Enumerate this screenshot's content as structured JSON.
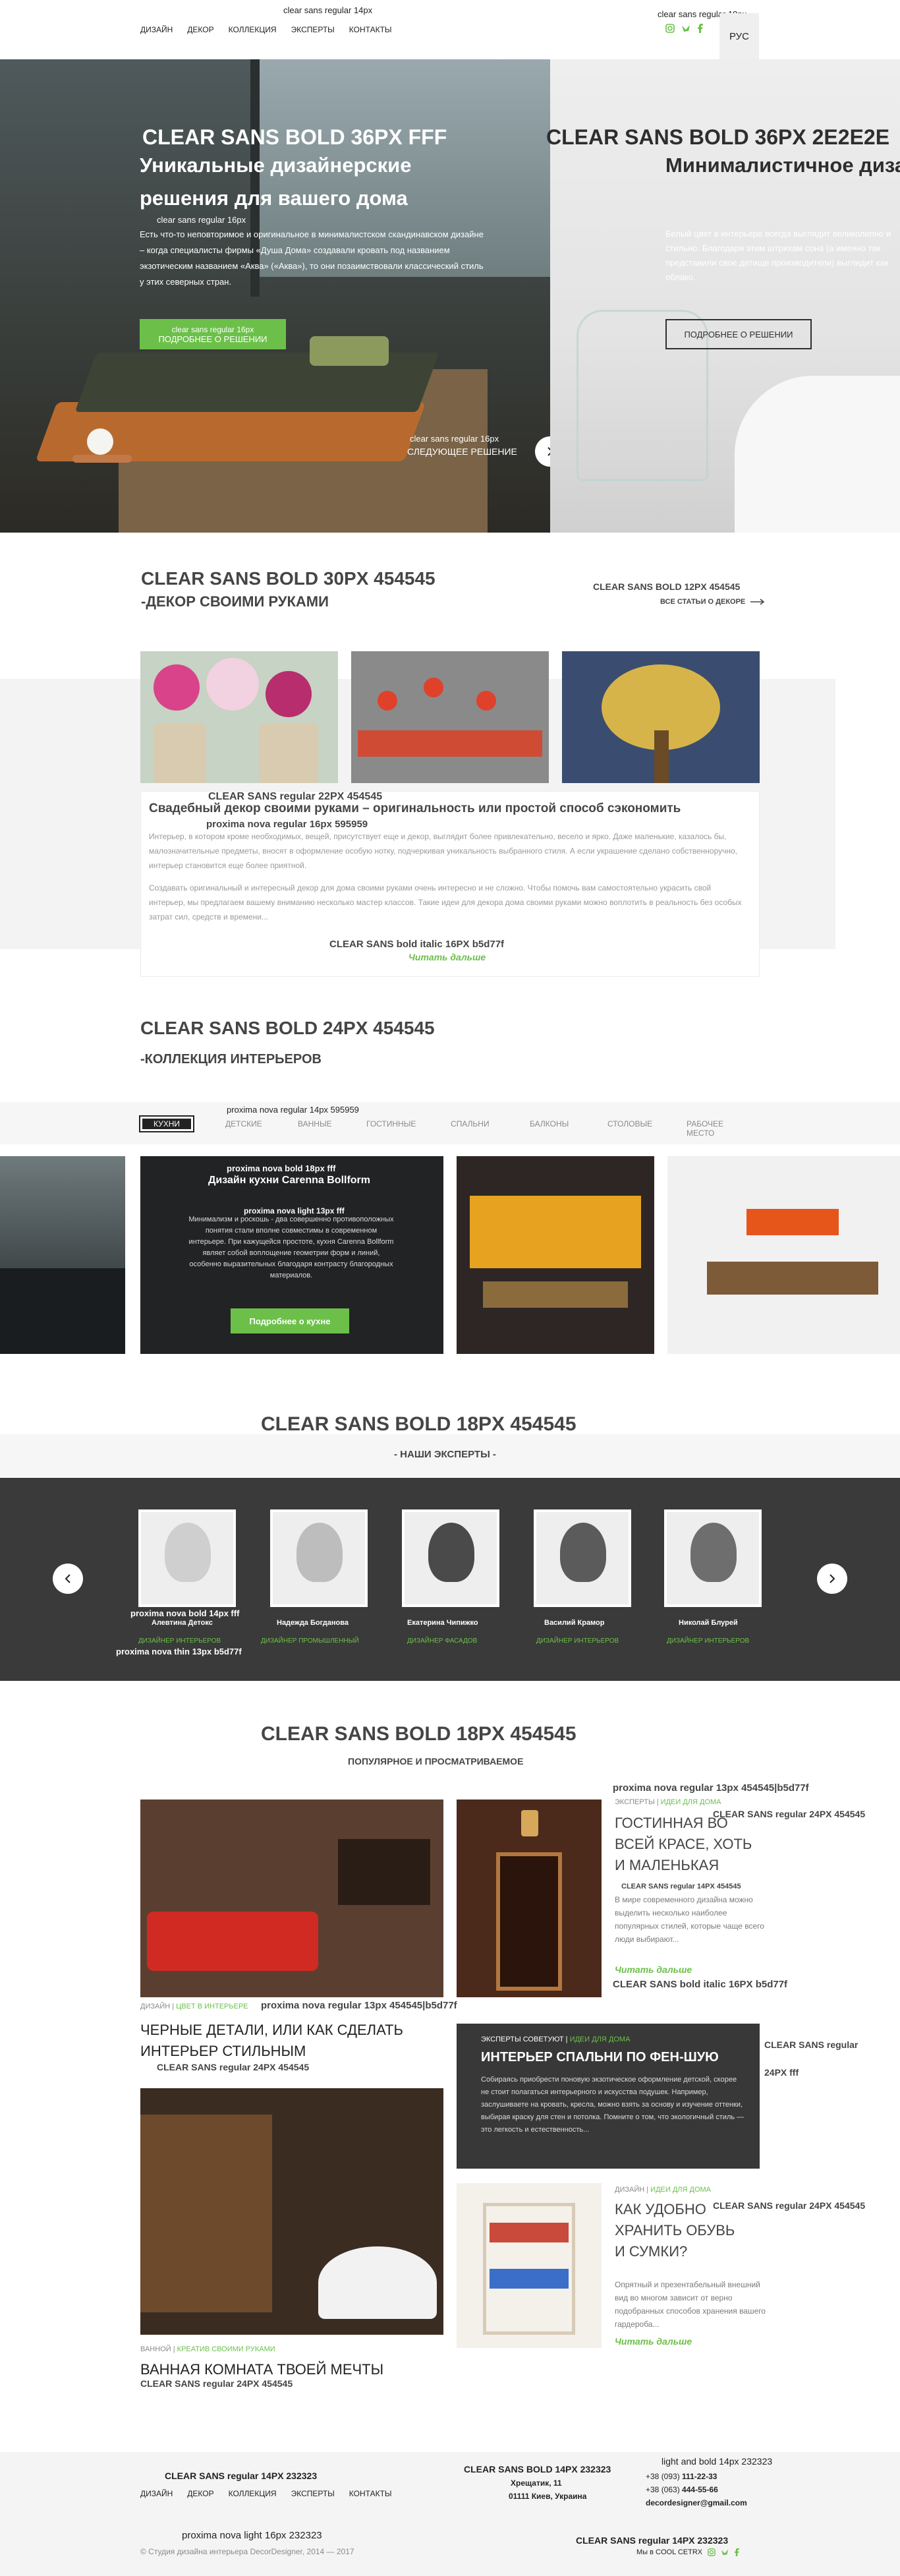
{
  "header": {
    "note_nav": "clear sans regular 14px",
    "nav": [
      "ДИЗАЙН",
      "ДЕКОР",
      "КОЛЛЕКЦИЯ",
      "ЭКСПЕРТЫ",
      "КОНТАКТЫ"
    ],
    "note_right": "clear sans regular 18px",
    "lang": "РУС",
    "social": [
      "instagram-icon",
      "twitter-icon",
      "facebook-icon"
    ],
    "accent": "#6cc04a"
  },
  "hero": {
    "left": {
      "note_title": "CLEAR SANS BOLD 36PX FFF",
      "title": "Уникальные дизайнерские решения для вашего дома",
      "note_text": "clear sans regular 16px",
      "text": "Есть что-то неповторимое и оригинальное в минималистском скандинавском дизайне – когда специалисты фирмы «Душа Дома» создавали кровать под названием экзотическим названием «Аква» («Аква»), то они позаимствовали классический стиль у этих северных стран.",
      "note_button": "clear sans regular 16px",
      "button": "ПОДРОБНЕЕ О РЕШЕНИИ",
      "note_next": "clear sans regular 16px",
      "next": "СЛЕДУЮЩЕЕ РЕШЕНИЕ"
    },
    "right": {
      "note_title": "CLEAR SANS BOLD 36PX 2E2E2E",
      "title": "Минималистичное дизайнерское исполнение в облачном стиле",
      "text": "Белый цвет в интерьере всегда выглядит великолепно и стильно. Благодаря этим штрихам сона (а именно так представили свое детище производители) выглядит как облако.",
      "button": "ПОДРОБНЕЕ О РЕШЕНИИ"
    }
  },
  "decor": {
    "note_title": "CLEAR SANS BOLD 30PX 454545",
    "title": "-ДЕКОР СВОИМИ РУКАМИ",
    "note_link": "CLEAR SANS BOLD 12PX 454545",
    "link": "ВСЕ СТАТЬИ О ДЕКОРЕ",
    "note_article_title": "CLEAR SANS regular 22PX 454545",
    "article_title": "Свадебный декор своими руками – оригинальность или простой способ сэкономить",
    "note_body": "proxima nova regular 16px 595959",
    "p1": "Интерьер, в котором кроме необходимых, вещей, присутствует еще и декор, выглядит более привлекательно, весело и ярко. Даже маленькие, казалось бы, малозначительные предметы, вносят в оформление особую нотку, подчеркивая уникальность выбранного стиля. А если украшение сделано собственноручно, интерьер становится еще более приятной.",
    "p2": "Создавать оригинальный и интересный декор для дома своими руками очень интересно и не сложно. Чтобы помочь вам самостоятельно украсить свой интерьер, мы предлагаем вашему вниманию несколько мастер классов. Такие идеи для декора дома своими руками можно воплотить в реальность без особых затрат сил, средств и времени...",
    "note_more": "CLEAR SANS bold italic 16PX b5d77f",
    "more": "Читать дальше"
  },
  "collection": {
    "note_title": "CLEAR SANS BOLD 24PX 454545",
    "title": "-КОЛЛЕКЦИЯ ИНТЕРЬЕРОВ",
    "note_tabs": "proxima nova regular 14px 595959",
    "tabs": [
      "КУХНИ",
      "ДЕТСКИЕ",
      "ВАННЫЕ",
      "ГОСТИННЫЕ",
      "СПАЛЬНИ",
      "БАЛКОНЫ",
      "СТОЛОВЫЕ",
      "РАБОЧЕЕ МЕСТО"
    ],
    "note_card_title": "proxima nova bold 18px fff",
    "card_title": "Дизайн кухни Carenna Bollform",
    "note_card_text": "proxima nova light 13px fff",
    "card_text": "Минимализм и роскошь - два совершенно противоположных понятия стали вполне совместимы в современном интерьере. При кажущейся простоте, кухня Carenna Bollform являет собой воплощение геометрии форм и линий, особенно выразительных благодаря контрасту благородных материалов.",
    "card_button": "Подробнее о кухне"
  },
  "experts": {
    "note_title": "CLEAR SANS BOLD 18PX 454545",
    "title": "- НАШИ ЭКСПЕРТЫ -",
    "note_name": "proxima nova bold 14px fff",
    "note_role": "proxima nova thin 13px b5d77f",
    "list": [
      {
        "name": "Алевтина Детокс",
        "role": "ДИЗАЙНЕР ИНТЕРЬЕРОВ"
      },
      {
        "name": "Надежда Богданова",
        "role": "ДИЗАЙНЕР ПРОМЫШЛЕННЫЙ"
      },
      {
        "name": "Екатерина Чипижко",
        "role": "ДИЗАЙНЕР ФАСАДОВ"
      },
      {
        "name": "Василий Крамор",
        "role": "ДИЗАЙНЕР ИНТЕРЬЕРОВ"
      },
      {
        "name": "Николай Блурей",
        "role": "ДИЗАЙНЕР ИНТЕРЬЕРОВ"
      }
    ]
  },
  "popular": {
    "note_title": "CLEAR SANS BOLD 18PX 454545",
    "title": "ПОПУЛЯРНОЕ И ПРОСМАТРИВАЕМОЕ",
    "note_cat": "proxima nova regular 13px 454545|b5d77f",
    "note_h": "CLEAR SANS regular 24PX 454545",
    "note_excerpt": "CLEAR SANS regular 14PX 454545",
    "note_more": "CLEAR SANS bold italic 16PX b5d77f",
    "note_h_white_1": "CLEAR SANS regular",
    "note_h_white_2": "24PX fff",
    "a1": {
      "cat": "ЭКСПЕРТЫ",
      "sub": "ИДЕИ ДЛЯ ДОМА",
      "title": "ГОСТИННАЯ ВО ВСЕЙ КРАСЕ, ХОТЬ И МАЛЕНЬКАЯ",
      "excerpt": "В мире современного дизайна можно выделить несколько наиболее популярных стилей, которые чаще всего люди выбирают...",
      "more": "Читать дальше"
    },
    "a2": {
      "cat": "ДИЗАЙН",
      "sub": "ЦВЕТ В ИНТЕРЬЕРЕ",
      "title": "ЧЕРНЫЕ ДЕТАЛИ, ИЛИ КАК СДЕЛАТЬ ИНТЕРЬЕР СТИЛЬНЫМ"
    },
    "a3": {
      "cat": "ЭКСПЕРТЫ СОВЕТУЮТ",
      "sub": "ИДЕИ ДЛЯ ДОМА",
      "title": "ИНТЕРЬЕР СПАЛЬНИ ПО ФЕН-ШУЮ",
      "excerpt": "Собираясь приобрести поновую экзотическое оформление детской, скорее не стоит полагаться интерьерного и искусства подушек. Например, заслушиваете на кровать, кресла, можно взять за основу и изучение оттенки, выбирая краску для стен и потолка. Помните о том, что экологичный стиль — это легкость и естественность..."
    },
    "a4": {
      "cat": "ВАННОЙ",
      "sub": "КРЕАТИВ СВОИМИ РУКАМИ",
      "title": "ВАННАЯ КОМНАТА ТВОЕЙ МЕЧТЫ"
    },
    "a5": {
      "cat": "ДИЗАЙН",
      "sub": "ИДЕИ ДЛЯ ДОМА",
      "title": "КАК УДОБНО ХРАНИТЬ ОБУВЬ И СУМКИ?",
      "excerpt": "Опрятный и презентабельный внешний вид во многом зависит от верно подобранных способов хранения вашего гардероба...",
      "more": "Читать дальше"
    }
  },
  "footer": {
    "note_nav": "CLEAR SANS regular 14PX 232323",
    "nav": [
      "ДИЗАЙН",
      "ДЕКОР",
      "КОЛЛЕКЦИЯ",
      "ЭКСПЕРТЫ",
      "КОНТАКТЫ"
    ],
    "note_address": "CLEAR SANS BOLD 14PX 232323",
    "address1": "Хрещатик, 11",
    "address2": "01111 Киев, Украина",
    "note_contacts": "light and bold 14px 232323",
    "phone1_pre": "+38 (093)",
    "phone1": "111-22-33",
    "phone2_pre": "+38 (063)",
    "phone2": "444-55-66",
    "email": "decordesigner@gmail.com",
    "note_copy": "proxima nova light 16px 232323",
    "copyright": "© Студия дизайна интерьера DecorDesigner, 2014 — 2017",
    "note_bottom_right": "CLEAR SANS regular 14PX 232323",
    "made_by": "Мы в COOL CETRX"
  }
}
